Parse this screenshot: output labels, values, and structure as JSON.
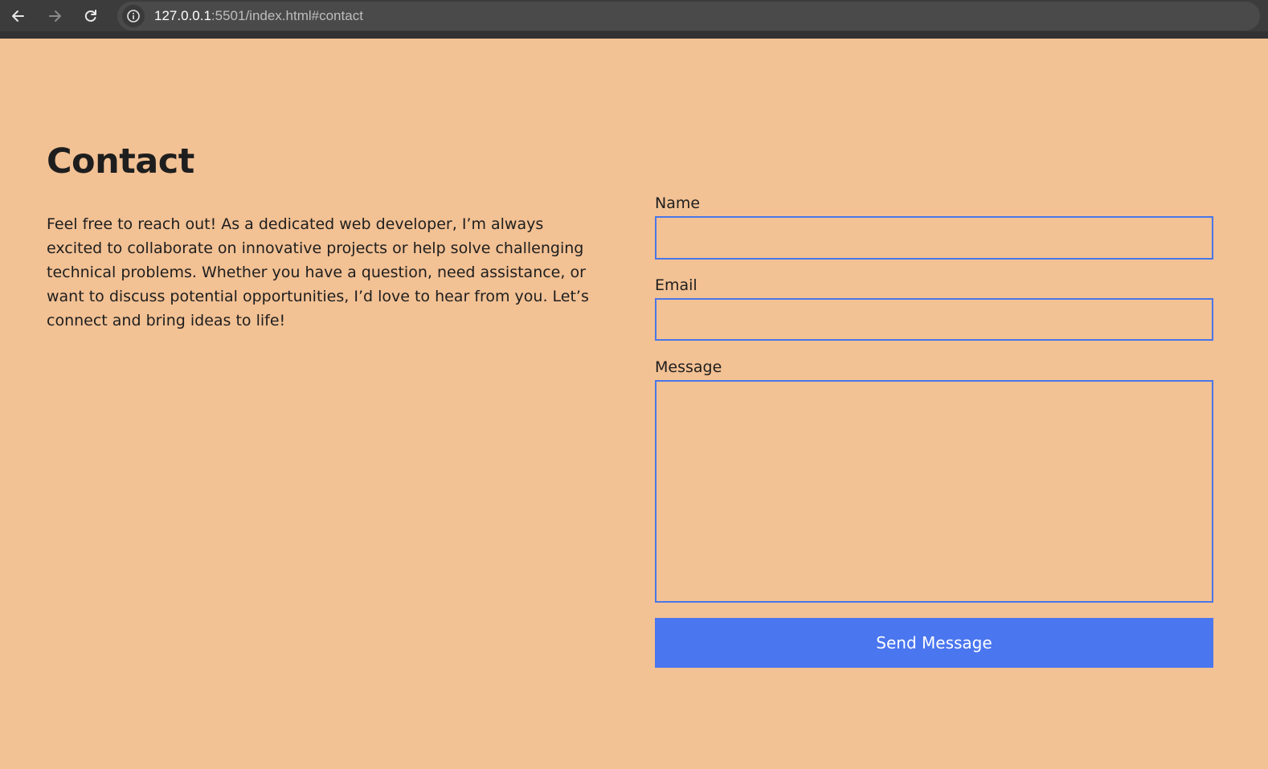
{
  "browser": {
    "url_host": "127.0.0.1",
    "url_path": ":5501/index.html#contact",
    "icons": {
      "back": "arrow-left",
      "forward": "arrow-right",
      "reload": "reload",
      "site_info": "info-circle"
    }
  },
  "contact": {
    "heading": "Contact",
    "intro": "Feel free to reach out! As a dedicated web developer, I’m always excited to collaborate on innovative projects or help solve challenging technical problems. Whether you have a question, need assistance, or want to discuss potential opportunities, I’d love to hear from you. Let’s connect and bring ideas to life!"
  },
  "form": {
    "name_label": "Name",
    "name_value": "",
    "email_label": "Email",
    "email_value": "",
    "message_label": "Message",
    "message_value": "",
    "submit_label": "Send Message"
  },
  "colors": {
    "page_background": "#f2c194",
    "accent": "#4a76ef",
    "field_border": "#4a76e8",
    "text": "#1e1e1e"
  }
}
